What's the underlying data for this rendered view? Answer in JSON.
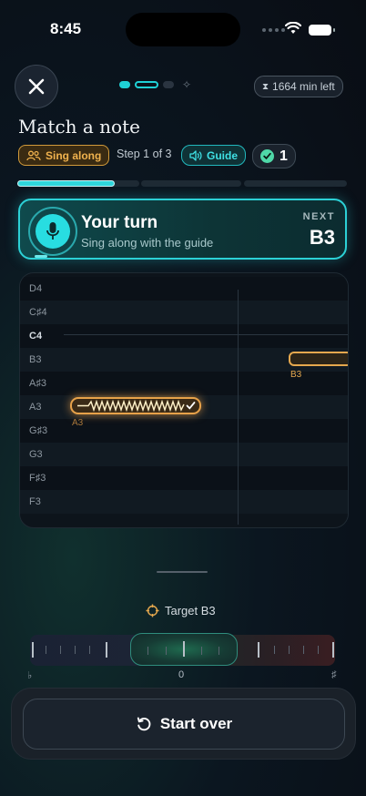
{
  "status_bar": {
    "time": "8:45"
  },
  "header": {
    "timer_label": "1664 min left",
    "title": "Match a note",
    "mode_chip": "Sing along",
    "step_text": "Step 1 of 3",
    "guide_chip": "Guide",
    "count": "1"
  },
  "progress": {
    "segment1_fill": 0.8,
    "segment2_fill": 0,
    "segment3_fill": 0
  },
  "turn_card": {
    "title": "Your turn",
    "subtitle": "Sing along with the guide",
    "next_label": "NEXT",
    "next_note": "B3"
  },
  "piano_roll": {
    "notes": [
      "D4",
      "C♯4",
      "C4",
      "B3",
      "A♯3",
      "A3",
      "G♯3",
      "G3",
      "F♯3",
      "F3"
    ],
    "sung_note_label": "A3",
    "target_note_label": "B3"
  },
  "target": {
    "label": "Target B3"
  },
  "tuner": {
    "flat": "♭",
    "zero": "0",
    "sharp": "♯"
  },
  "actions": {
    "start_over": "Start over"
  },
  "colors": {
    "accent": "#2cd1d6",
    "warning": "#e5a84e",
    "success": "#4fd8a8"
  }
}
